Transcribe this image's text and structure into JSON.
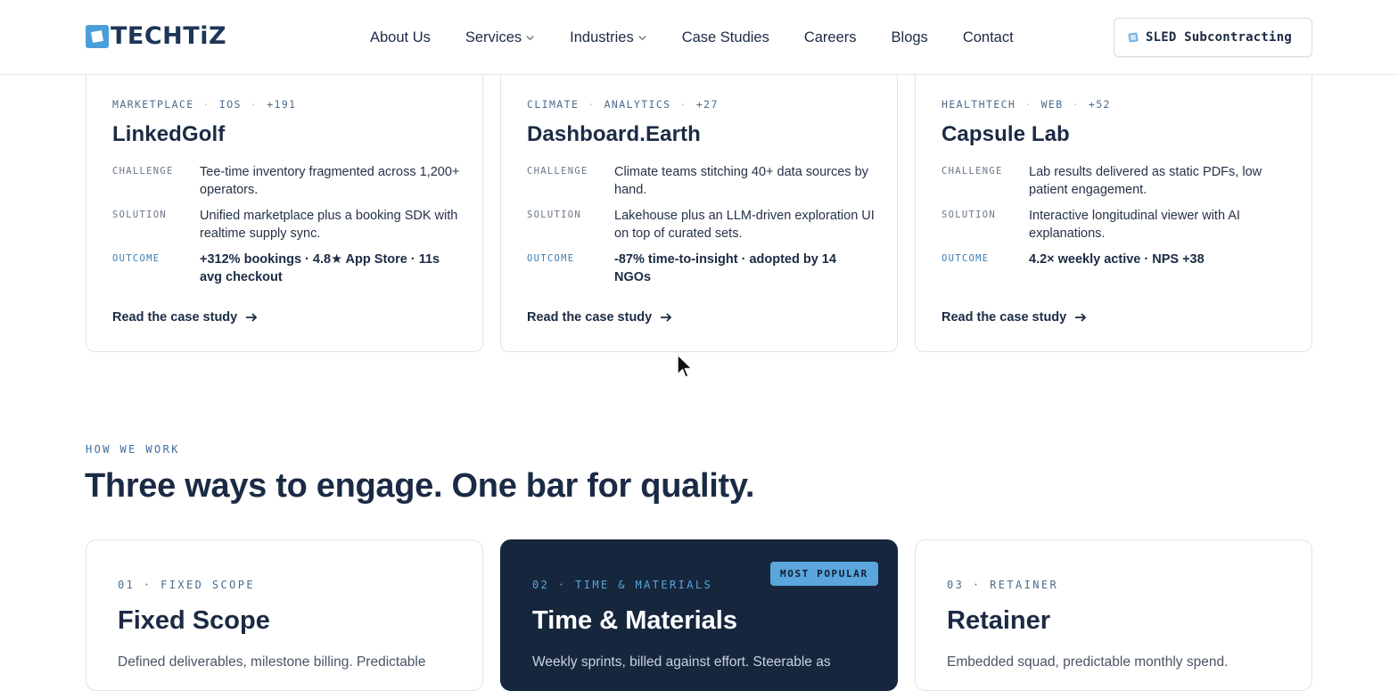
{
  "header": {
    "logo_text": "TECHTiZ",
    "nav": [
      {
        "label": "About Us",
        "has_dropdown": false
      },
      {
        "label": "Services",
        "has_dropdown": true
      },
      {
        "label": "Industries",
        "has_dropdown": true
      },
      {
        "label": "Case Studies",
        "has_dropdown": false
      },
      {
        "label": "Careers",
        "has_dropdown": false
      },
      {
        "label": "Blogs",
        "has_dropdown": false
      },
      {
        "label": "Contact",
        "has_dropdown": false
      }
    ],
    "cta_label": "SLED Subcontracting"
  },
  "case_studies": [
    {
      "tag1": "MARKETPLACE",
      "tag2": "IOS",
      "tag3": "+191",
      "title": "LinkedGolf",
      "challenge_key": "CHALLENGE",
      "challenge": "Tee-time inventory fragmented across 1,200+ operators.",
      "solution_key": "SOLUTION",
      "solution": "Unified marketplace plus a booking SDK with realtime supply sync.",
      "outcome_key": "OUTCOME",
      "outcome": "+312% bookings · 4.8★ App Store · 11s avg checkout",
      "link": "Read the case study"
    },
    {
      "tag1": "CLIMATE",
      "tag2": "ANALYTICS",
      "tag3": "+27",
      "title": "Dashboard.Earth",
      "challenge_key": "CHALLENGE",
      "challenge": "Climate teams stitching 40+ data sources by hand.",
      "solution_key": "SOLUTION",
      "solution": "Lakehouse plus an LLM-driven exploration UI on top of curated sets.",
      "outcome_key": "OUTCOME",
      "outcome": "-87% time-to-insight · adopted by 14 NGOs",
      "link": "Read the case study"
    },
    {
      "tag1": "HEALTHTECH",
      "tag2": "WEB",
      "tag3": "+52",
      "title": "Capsule Lab",
      "challenge_key": "CHALLENGE",
      "challenge": "Lab results delivered as static PDFs, low patient engagement.",
      "solution_key": "SOLUTION",
      "solution": "Interactive longitudinal viewer with AI explanations.",
      "outcome_key": "OUTCOME",
      "outcome": "4.2× weekly active · NPS +38",
      "link": "Read the case study"
    }
  ],
  "how_we_work": {
    "eyebrow": "HOW WE WORK",
    "title": "Three ways to engage. One bar for quality.",
    "plans": [
      {
        "eyebrow": "01 · FIXED SCOPE",
        "title": "Fixed Scope",
        "desc": "Defined deliverables, milestone billing. Predictable"
      },
      {
        "eyebrow": "02 · TIME & MATERIALS",
        "title": "Time & Materials",
        "desc": "Weekly sprints, billed against effort. Steerable as",
        "badge": "MOST POPULAR"
      },
      {
        "eyebrow": "03 · RETAINER",
        "title": "Retainer",
        "desc": "Embedded squad, predictable monthly spend."
      }
    ]
  },
  "colors": {
    "navy": "#1b2b45",
    "accent_blue": "#4a9fd8",
    "dark_card": "#16263d",
    "badge": "#5aa6dd"
  }
}
